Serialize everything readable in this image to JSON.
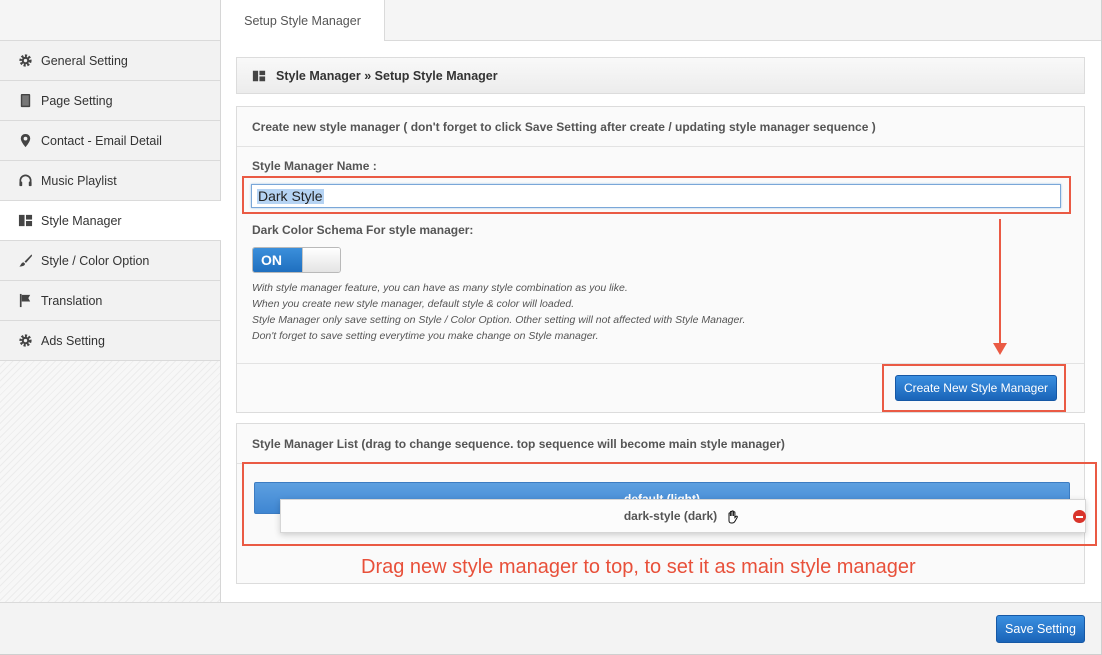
{
  "tab": {
    "label": "Setup Style Manager"
  },
  "sidebar": {
    "items": [
      {
        "label": "General Setting",
        "icon": "gear-icon"
      },
      {
        "label": "Page Setting",
        "icon": "page-icon"
      },
      {
        "label": "Contact - Email Detail",
        "icon": "map-pin-icon"
      },
      {
        "label": "Music Playlist",
        "icon": "headphones-icon"
      },
      {
        "label": "Style Manager",
        "icon": "layout-icon",
        "active": true
      },
      {
        "label": "Style / Color Option",
        "icon": "brush-icon"
      },
      {
        "label": "Translation",
        "icon": "flag-icon"
      },
      {
        "label": "Ads Setting",
        "icon": "gear-icon"
      }
    ]
  },
  "breadcrumb": {
    "text": "Style Manager » Setup Style Manager"
  },
  "create_panel": {
    "heading": "Create new style manager ( don't forget to click Save Setting after create / updating style manager sequence )",
    "name_label": "Style Manager Name :",
    "name_value": "Dark Style",
    "schema_label": "Dark Color Schema For style manager:",
    "toggle_label": "ON",
    "help_lines": [
      "With style manager feature, you can have as many style combination as you like.",
      "When you create new style manager, default style & color will loaded.",
      "Style Manager only save setting on Style / Color Option. Other setting will not affected with Style Manager.",
      "Don't forget to save setting everytime you make change on Style manager."
    ],
    "create_button": "Create New Style Manager"
  },
  "list_panel": {
    "heading": "Style Manager List (drag to change sequence. top sequence will become main style manager)",
    "items": [
      {
        "label": "default (light)"
      },
      {
        "label": "dark-style (dark)"
      }
    ]
  },
  "annotation": "Drag new style manager to top, to set it as main style manager",
  "save_button": "Save Setting",
  "colors": {
    "accent": "#2b7bd0",
    "annotation": "#ea5a44"
  }
}
